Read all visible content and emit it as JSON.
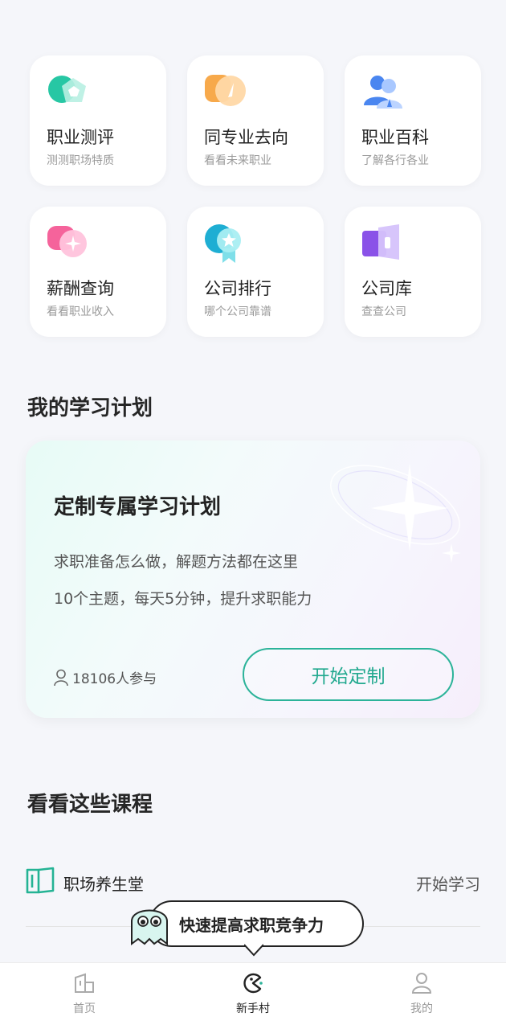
{
  "tools": [
    {
      "title": "职业测评",
      "subtitle": "测测职场特质",
      "icon": "pentagon-badge-icon"
    },
    {
      "title": "同专业去向",
      "subtitle": "看看未来职业",
      "icon": "compass-icon"
    },
    {
      "title": "职业百科",
      "subtitle": "了解各行各业",
      "icon": "people-icon"
    },
    {
      "title": "薪酬查询",
      "subtitle": "看看职业收入",
      "icon": "chat-sparkle-icon"
    },
    {
      "title": "公司排行",
      "subtitle": "哪个公司靠谱",
      "icon": "ribbon-star-icon"
    },
    {
      "title": "公司库",
      "subtitle": "查查公司",
      "icon": "door-icon"
    }
  ],
  "plan_section": {
    "title": "我的学习计划"
  },
  "plan_card": {
    "title": "定制专属学习计划",
    "line1": "求职准备怎么做，解题方法都在这里",
    "line2": "10个主题，每天5分钟，提升求职能力",
    "participants": "18106人参与",
    "button": "开始定制"
  },
  "courses_section": {
    "title": "看看这些课程"
  },
  "courses": [
    {
      "name": "职场养生堂",
      "action": "开始学习",
      "icon": "book-icon"
    }
  ],
  "tooltip": {
    "text": "快速提高求职竞争力"
  },
  "tabbar": [
    {
      "label": "首页",
      "icon": "home-icon",
      "active": false
    },
    {
      "label": "新手村",
      "icon": "pacman-icon",
      "active": true
    },
    {
      "label": "我的",
      "icon": "user-icon",
      "active": false
    }
  ],
  "colors": {
    "accent": "#2bb399",
    "background": "#f5f6fa"
  }
}
